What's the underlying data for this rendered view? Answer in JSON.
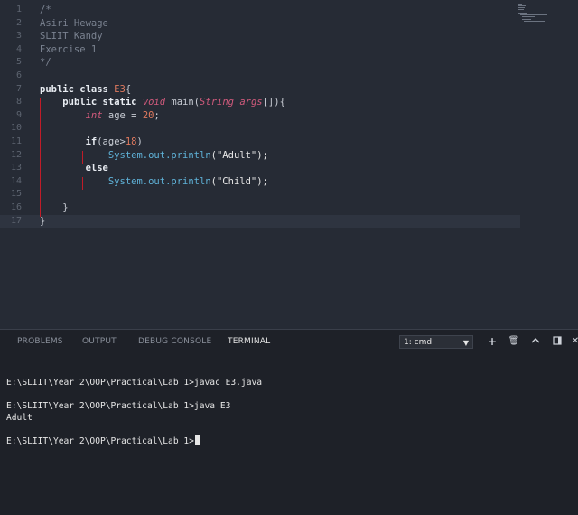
{
  "editor": {
    "lines": [
      {
        "n": "1",
        "tokens": [
          {
            "t": "/*",
            "c": "cm"
          }
        ]
      },
      {
        "n": "2",
        "tokens": [
          {
            "t": "Asiri Hewage",
            "c": "cm"
          }
        ]
      },
      {
        "n": "3",
        "tokens": [
          {
            "t": "SLIIT Kandy",
            "c": "cm"
          }
        ]
      },
      {
        "n": "4",
        "tokens": [
          {
            "t": "Exercise 1",
            "c": "cm"
          }
        ]
      },
      {
        "n": "5",
        "tokens": [
          {
            "t": "*/",
            "c": "cm"
          }
        ]
      },
      {
        "n": "6",
        "tokens": []
      },
      {
        "n": "7",
        "tokens": [
          {
            "t": "public class ",
            "c": "kw"
          },
          {
            "t": "E3",
            "c": "nm"
          },
          {
            "t": "{",
            "c": "cls"
          }
        ]
      },
      {
        "n": "8",
        "tokens": [
          {
            "t": "    "
          },
          {
            "t": "public static ",
            "c": "kw"
          },
          {
            "t": "void",
            "c": "ty"
          },
          {
            "t": " main(",
            "c": "cls"
          },
          {
            "t": "String",
            "c": "ty"
          },
          {
            "t": " ",
            "c": "cls"
          },
          {
            "t": "args",
            "c": "ty"
          },
          {
            "t": "[]){",
            "c": "cls"
          }
        ]
      },
      {
        "n": "9",
        "tokens": [
          {
            "t": "        "
          },
          {
            "t": "int",
            "c": "ty"
          },
          {
            "t": " age = ",
            "c": "cls"
          },
          {
            "t": "20",
            "c": "nm"
          },
          {
            "t": ";",
            "c": "cls"
          }
        ]
      },
      {
        "n": "10",
        "tokens": []
      },
      {
        "n": "11",
        "tokens": [
          {
            "t": "        "
          },
          {
            "t": "if",
            "c": "kw"
          },
          {
            "t": "(age>",
            "c": "cls"
          },
          {
            "t": "18",
            "c": "nm"
          },
          {
            "t": ")",
            "c": "cls"
          }
        ]
      },
      {
        "n": "12",
        "tokens": [
          {
            "t": "            "
          },
          {
            "t": "System.out.println",
            "c": "fn"
          },
          {
            "t": "(\"Adult\");",
            "c": "str"
          }
        ]
      },
      {
        "n": "13",
        "tokens": [
          {
            "t": "        "
          },
          {
            "t": "else",
            "c": "kw"
          }
        ]
      },
      {
        "n": "14",
        "tokens": [
          {
            "t": "            "
          },
          {
            "t": "System.out.println",
            "c": "fn"
          },
          {
            "t": "(\"Child\");",
            "c": "str"
          }
        ]
      },
      {
        "n": "15",
        "tokens": []
      },
      {
        "n": "16",
        "tokens": [
          {
            "t": "    "
          },
          {
            "t": "}",
            "c": "cls"
          }
        ]
      },
      {
        "n": "17",
        "tokens": [
          {
            "t": "}",
            "c": "cls"
          }
        ]
      }
    ],
    "current_line": 17
  },
  "panel": {
    "tabs": [
      "PROBLEMS",
      "OUTPUT",
      "DEBUG CONSOLE",
      "TERMINAL"
    ],
    "active_tab": "TERMINAL",
    "terminal_select": "1: cmd",
    "buttons": {
      "add": "+",
      "kill": "🗑",
      "maximize": "^",
      "split": "▯",
      "close": "✕"
    }
  },
  "terminal": {
    "lines": [
      "E:\\SLIIT\\Year 2\\OOP\\Practical\\Lab 1>javac E3.java",
      "",
      "E:\\SLIIT\\Year 2\\OOP\\Practical\\Lab 1>java E3",
      "Adult",
      "",
      "E:\\SLIIT\\Year 2\\OOP\\Practical\\Lab 1>"
    ]
  },
  "colors": {
    "editor_bg": "#262b35",
    "panel_bg": "#1e2128",
    "comment": "#7a8290",
    "keyword": "#e8ecf2",
    "type": "#d05a7c",
    "number": "#e07a5f",
    "function": "#5fb2d8"
  }
}
